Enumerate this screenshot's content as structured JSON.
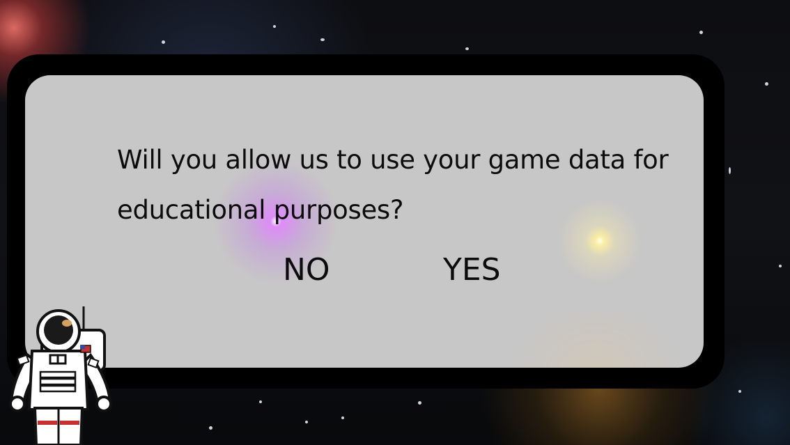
{
  "dialog": {
    "question_line1": "Will you allow us to use your game data for",
    "question_line2": "educational purposes?",
    "no_label": "NO",
    "yes_label": "YES"
  },
  "colors": {
    "panel": "#d6d6d6",
    "frame": "#000000",
    "text": "#0c0c0c"
  },
  "icons": {
    "mascot": "astronaut-icon"
  }
}
